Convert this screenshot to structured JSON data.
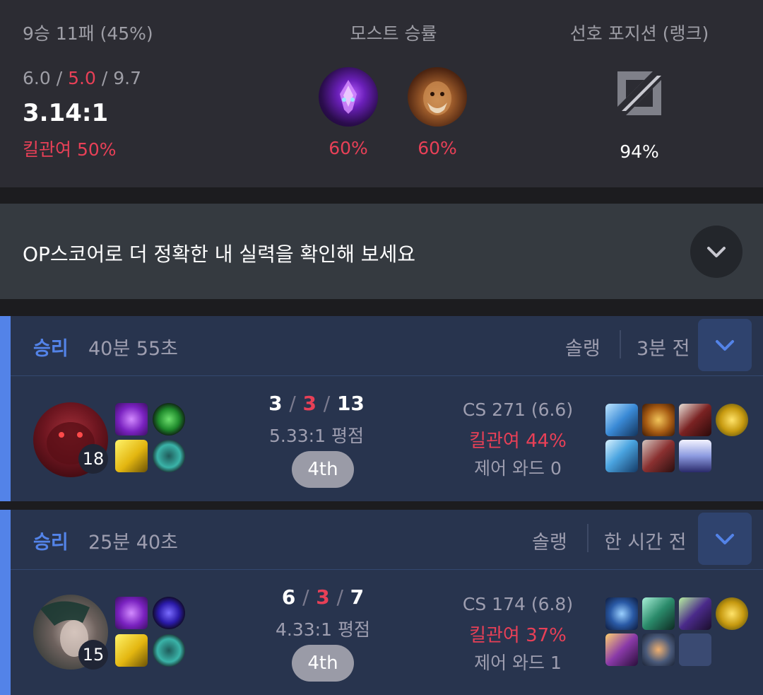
{
  "summary": {
    "record": "9승 11패 (45%)",
    "kda_kills": "6.0",
    "kda_deaths": "5.0",
    "kda_assists": "9.7",
    "kda_sep": "/",
    "ratio": "3.14:1",
    "kill_participation": "킬관여 50%",
    "most_title": "모스트 승률",
    "most": [
      {
        "winrate": "60%"
      },
      {
        "winrate": "60%"
      }
    ],
    "position_title": "선호 포지션 (랭크)",
    "position_pct": "94%"
  },
  "banner": {
    "text": "OP스코어로 더 정확한 내 실력을 확인해 보세요"
  },
  "matches": [
    {
      "result": "승리",
      "duration": "40분 55초",
      "queue": "솔랭",
      "time_ago": "3분 전",
      "level": "18",
      "kills": "3",
      "deaths": "3",
      "assists": "13",
      "ratio": "5.33:1 평점",
      "placement": "4th",
      "cs": "CS 271 (6.6)",
      "kill_participation": "킬관여 44%",
      "control_wards": "제어 와드 0"
    },
    {
      "result": "승리",
      "duration": "25분 40초",
      "queue": "솔랭",
      "time_ago": "한 시간 전",
      "level": "15",
      "kills": "6",
      "deaths": "3",
      "assists": "7",
      "ratio": "4.33:1 평점",
      "placement": "4th",
      "cs": "CS 174 (6.8)",
      "kill_participation": "킬관여 37%",
      "control_wards": "제어 와드 1"
    }
  ],
  "colors": {
    "accent_blue": "#5383e8",
    "loss_red": "#e84057",
    "card_bg": "#28344e"
  }
}
